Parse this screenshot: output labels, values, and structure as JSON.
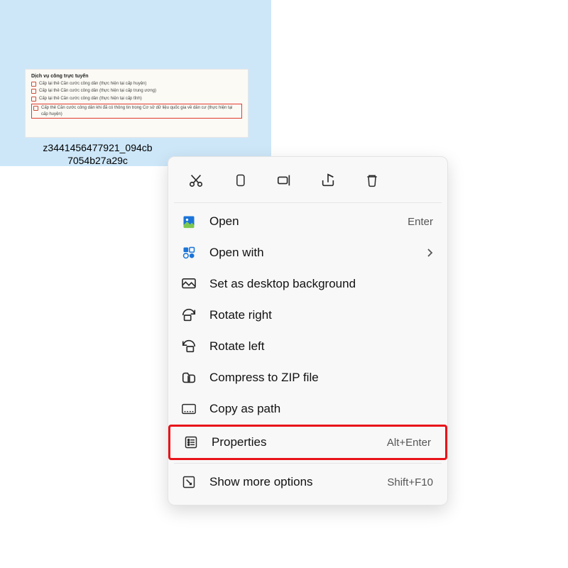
{
  "file": {
    "name_line1": "z3441456477921_094cb",
    "name_line2": "7054b27a29c"
  },
  "thumb": {
    "title": "Dịch vụ công trực tuyến",
    "lines": [
      "Cấp lại thẻ Căn cước công dân (thực hiện tại cấp huyện)",
      "Cấp lại thẻ Căn cước công dân (thực hiện tại cấp trung ương)",
      "Cấp lại thẻ Căn cước công dân (thực hiện tại cấp tỉnh)",
      "Cấp thẻ Căn cước công dân khi đã có thông tin trong Cơ sở dữ liệu quốc gia về dân cư (thực hiện tại cấp huyện)"
    ]
  },
  "iconrow": {
    "cut": "cut-icon",
    "copy": "copy-icon",
    "rename": "rename-icon",
    "share": "share-icon",
    "delete": "delete-icon"
  },
  "menu": {
    "open": {
      "label": "Open",
      "shortcut": "Enter"
    },
    "open_with": {
      "label": "Open with"
    },
    "set_bg": {
      "label": "Set as desktop background"
    },
    "rotate_right": {
      "label": "Rotate right"
    },
    "rotate_left": {
      "label": "Rotate left"
    },
    "compress": {
      "label": "Compress to ZIP file"
    },
    "copy_path": {
      "label": "Copy as path"
    },
    "properties": {
      "label": "Properties",
      "shortcut": "Alt+Enter"
    },
    "more": {
      "label": "Show more options",
      "shortcut": "Shift+F10"
    }
  }
}
